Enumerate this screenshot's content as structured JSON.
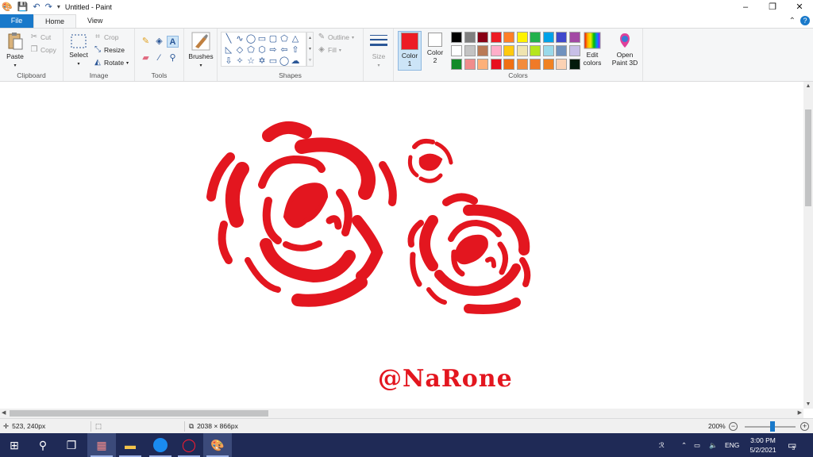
{
  "window": {
    "title": "Untitled - Paint",
    "minimize_icon": "minimize-icon",
    "restore_icon": "restore-icon",
    "close_icon": "close-icon"
  },
  "menu": {
    "file": "File",
    "home": "Home",
    "view": "View"
  },
  "ribbon": {
    "clipboard": {
      "label": "Clipboard",
      "paste": "Paste",
      "cut": "Cut",
      "copy": "Copy"
    },
    "image": {
      "label": "Image",
      "select": "Select",
      "crop": "Crop",
      "resize": "Resize",
      "rotate": "Rotate"
    },
    "tools": {
      "label": "Tools"
    },
    "brushes": {
      "label": "Brushes"
    },
    "shapes": {
      "label": "Shapes",
      "outline": "Outline",
      "fill": "Fill"
    },
    "size": {
      "label": "Size"
    },
    "colors": {
      "label": "Colors",
      "color1": "Color",
      "color1_num": "1",
      "color2": "Color",
      "color2_num": "2",
      "edit_colors": "Edit",
      "edit_colors2": "colors",
      "open_paint3d": "Open",
      "open_paint3d2": "Paint 3D",
      "color1_value": "#ed1c24",
      "color2_value": "#ffffff",
      "palette_row1": [
        "#000000",
        "#7f7f7f",
        "#880015",
        "#ed1c24",
        "#ff7f27",
        "#fff200",
        "#22b14c",
        "#00a2e8",
        "#3f48cc",
        "#a349a4"
      ],
      "palette_row2": [
        "#ffffff",
        "#c3c3c3",
        "#b97a57",
        "#ffaec9",
        "#ffc90e",
        "#efe4b0",
        "#b5e61d",
        "#99d9ea",
        "#7092be",
        "#c8bfe7"
      ],
      "palette_row3": [
        "#138a28",
        "#f08c8c",
        "#fdb07a",
        "#e8101e",
        "#f07014",
        "#f38c3c",
        "#f07a28",
        "#f08222",
        "#fbd2b4",
        "#031a0c"
      ]
    }
  },
  "canvas": {
    "signature": "@NaRone",
    "ink_color": "#e3161f"
  },
  "status": {
    "cursor_pos": "523, 240px",
    "image_size": "2038 × 866px",
    "zoom": "200%"
  },
  "taskbar": {
    "lang": "ENG",
    "time": "3:00 PM",
    "date": "5/2/2021",
    "notifications": "3"
  }
}
